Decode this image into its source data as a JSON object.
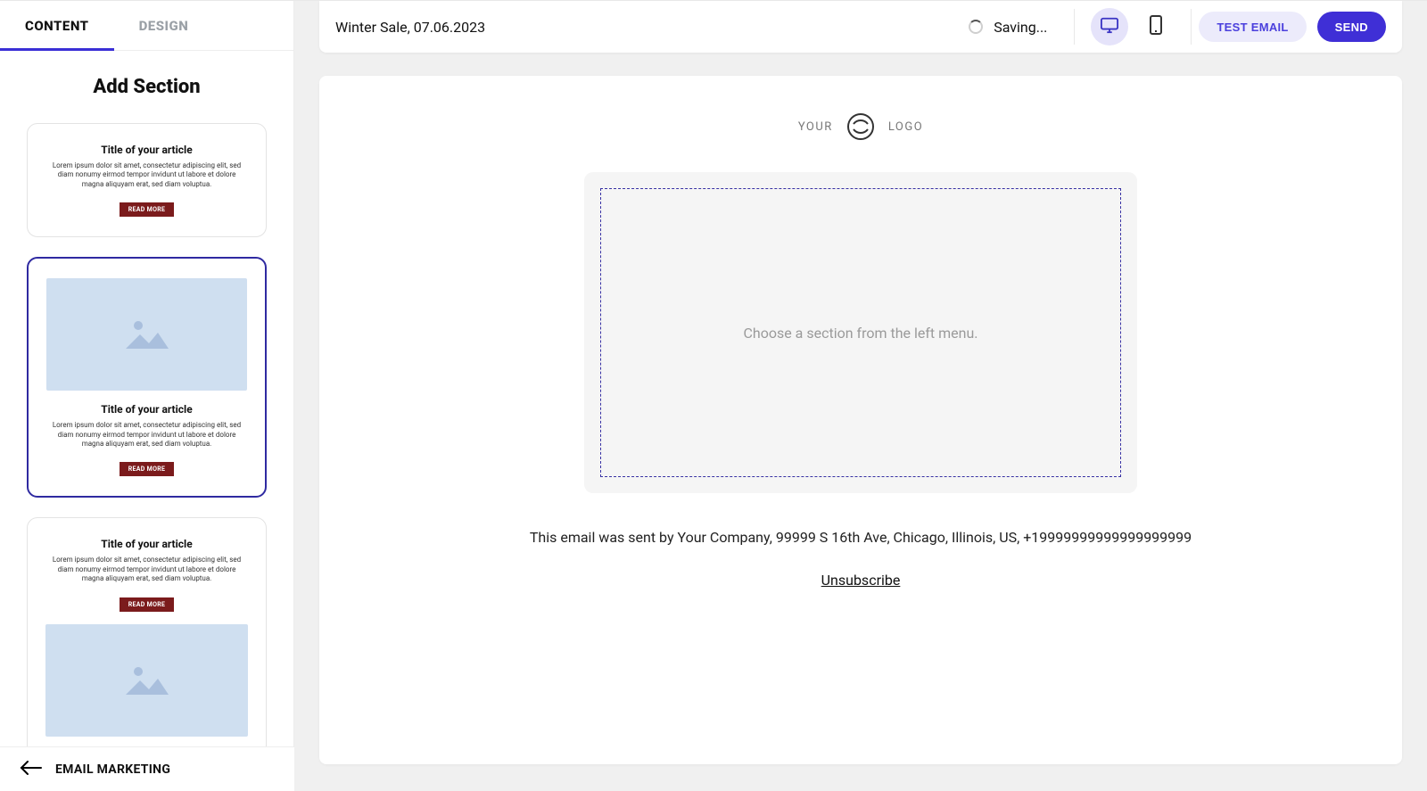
{
  "sidebar": {
    "tabs": {
      "content": "CONTENT",
      "design": "DESIGN"
    },
    "title": "Add Section",
    "template": {
      "title": "Title of your article",
      "body": "Lorem ipsum dolor sit amet, consectetur adipiscing elit, sed diam nonumy eirmod tempor invidunt ut labore et dolore magna aliquyam erat, sed diam voluptua.",
      "button": "READ MORE"
    }
  },
  "backbar": {
    "label": "EMAIL MARKETING"
  },
  "topbar": {
    "title": "Winter Sale, 07.06.2023",
    "saving": "Saving...",
    "test": "TEST EMAIL",
    "send": "SEND"
  },
  "canvas": {
    "logo": {
      "left": "YOUR",
      "right": "LOGO"
    },
    "placeholder": "Choose a section from the left menu.",
    "footer": "This email was sent by Your Company, 99999 S 16th Ave, Chicago, Illinois, US, +19999999999999999999",
    "unsubscribe": "Unsubscribe"
  },
  "colors": {
    "accent": "#3a2fd6",
    "card_button_bg": "#7b1b1c",
    "image_placeholder_bg": "#cfdff0"
  }
}
